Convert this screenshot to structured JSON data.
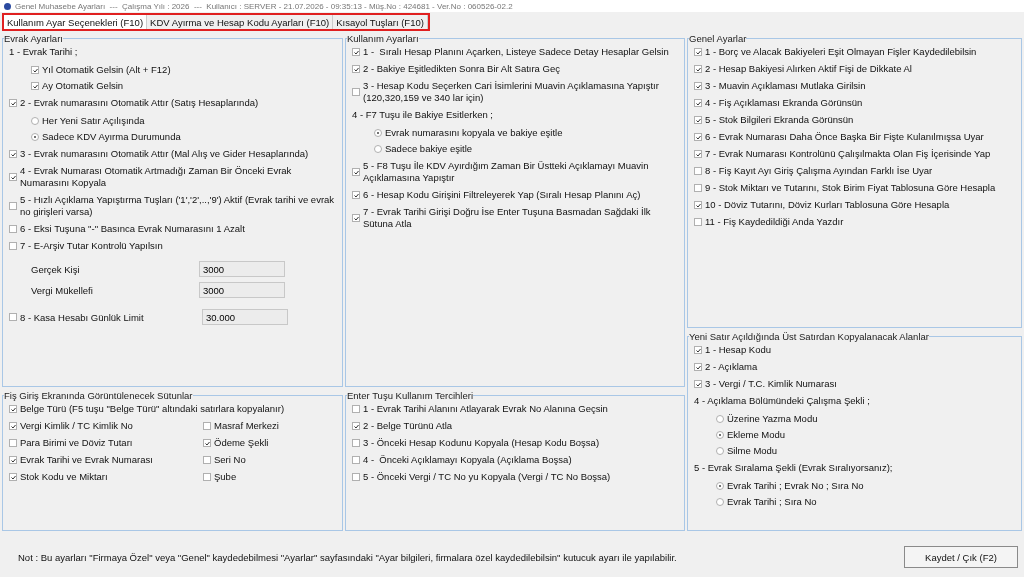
{
  "window": {
    "title": "Genel Muhasebe Ayarları  ---  Çalışma Yılı : 2026  ---  Kullanıcı : SERVER - 21.07.2026 - 09:35:13 - Müş.No : 424681 - Ver.No : 060526-02.2"
  },
  "tabs": [
    {
      "label": "Kullanım Ayar Seçenekleri (F10)",
      "selected": true
    },
    {
      "label": "KDV Ayırma ve Hesap Kodu Ayarları (F10)",
      "selected": false
    },
    {
      "label": "Kısayol Tuşları (F10)",
      "selected": false
    }
  ],
  "columns": [
    [
      {
        "title": "Evrak Ayarları",
        "items": [
          {
            "kind": "label",
            "text": "1 - Evrak Tarihi ;",
            "children": [
              {
                "kind": "check",
                "text": "Yıl Otomatik Gelsin (Alt + F12)",
                "checked": true
              },
              {
                "kind": "check",
                "text": "Ay Otomatik Gelsin",
                "checked": true
              }
            ]
          },
          {
            "kind": "check",
            "text": "2 - Evrak numarasını Otomatik Attır (Satış Hesaplarında)",
            "checked": true,
            "children": [
              {
                "kind": "radio",
                "text": "Her Yeni Satır Açılışında",
                "selected": false
              },
              {
                "kind": "radio",
                "text": "Sadece KDV Ayırma Durumunda",
                "selected": true
              }
            ]
          },
          {
            "kind": "check",
            "text": "3 - Evrak numarasını Otomatik Attır (Mal Alış ve Gider Hesaplarında)",
            "checked": true
          },
          {
            "kind": "check",
            "text": "4 - Evrak Numarası Otomatik Artmadığı Zaman Bir Önceki Evrak Numarasını Kopyala",
            "checked": true
          },
          {
            "kind": "check",
            "text": "5 - Hızlı Açıklama Yapıştırma Tuşları ('1','2',..,'9') Aktif (Evrak tarihi ve evrak no girişleri varsa)",
            "checked": false
          },
          {
            "kind": "check",
            "text": "6 - Eksi Tuşuna \"-\" Basınca Evrak Numarasını 1 Azalt",
            "checked": false
          },
          {
            "kind": "check",
            "text": "7 - E-Arşiv Tutar Kontrolü Yapılsın",
            "checked": false,
            "children": [
              {
                "kind": "field",
                "text": "Gerçek Kişi",
                "value": "3000"
              },
              {
                "kind": "field",
                "text": "Vergi Mükellefi",
                "value": "3000"
              }
            ]
          },
          {
            "kind": "check_field",
            "text": "8 - Kasa Hesabı Günlük Limit",
            "checked": false,
            "value": "30.000"
          }
        ]
      },
      {
        "title": "Fiş Giriş Ekranında Görüntülenecek Sütunlar",
        "items": [
          {
            "kind": "check",
            "text": "Belge Türü (F5 tuşu \"Belge Türü\" altındaki satırlara kopyalanır)",
            "checked": true
          },
          {
            "kind": "pair",
            "cells": [
              {
                "text": "Vergi Kimlik / TC Kimlik No",
                "checked": true
              },
              {
                "text": "Masraf Merkezi",
                "checked": false
              }
            ]
          },
          {
            "kind": "pair",
            "cells": [
              {
                "text": "Para Birimi ve Döviz Tutarı",
                "checked": false
              },
              {
                "text": "Ödeme Şekli",
                "checked": true
              }
            ]
          },
          {
            "kind": "pair",
            "cells": [
              {
                "text": "Evrak Tarihi ve Evrak Numarası",
                "checked": true
              },
              {
                "text": "Seri No",
                "checked": false
              }
            ]
          },
          {
            "kind": "pair",
            "cells": [
              {
                "text": "Stok Kodu ve Miktarı",
                "checked": true
              },
              {
                "text": "Şube",
                "checked": false
              }
            ]
          }
        ]
      }
    ],
    [
      {
        "title": "Kullanım Ayarları",
        "items": [
          {
            "kind": "check",
            "text": "1 -  Sıralı Hesap Planını Açarken, Listeye Sadece Detay Hesaplar Gelsin",
            "checked": true
          },
          {
            "kind": "check",
            "text": "2 - Bakiye Eşitledikten Sonra Bir Alt Satıra Geç",
            "checked": true
          },
          {
            "kind": "check",
            "text": "3 - Hesap Kodu Seçerken Cari İsimlerini Muavin Açıklamasına Yapıştır (120,320,159 ve 340 lar için)",
            "checked": false
          },
          {
            "kind": "label",
            "text": "4 - F7 Tuşu ile Bakiye Esitlerken ;",
            "children": [
              {
                "kind": "radio",
                "text": "Evrak numarasını kopyala ve bakiye eşitle",
                "selected": true
              },
              {
                "kind": "radio",
                "text": "Sadece bakiye eşitle",
                "selected": false
              }
            ]
          },
          {
            "kind": "check",
            "text": "5 - F8 Tuşu İle KDV Ayırdığım Zaman Bir Üstteki Açıklamayı Muavin Açıklamasına Yapıştır",
            "checked": true
          },
          {
            "kind": "check",
            "text": "6 - Hesap Kodu Girişini Filtreleyerek Yap (Sıralı Hesap Planını Aç)",
            "checked": true
          },
          {
            "kind": "check",
            "text": "7 - Evrak Tarihi Girişi Doğru İse Enter Tuşuna Basmadan Sağdaki İlk Sütuna Atla",
            "checked": true
          }
        ]
      },
      {
        "title": "Enter Tuşu Kullanım Tercihleri",
        "items": [
          {
            "kind": "check",
            "text": "1 - Evrak Tarihi Alanını Atlayarak Evrak No Alanına Geçsin",
            "checked": false
          },
          {
            "kind": "check",
            "text": "2 - Belge Türünü Atla",
            "checked": true
          },
          {
            "kind": "check",
            "text": "3 - Önceki Hesap Kodunu Kopyala (Hesap Kodu Boşsa)",
            "checked": false
          },
          {
            "kind": "check",
            "text": "4 -  Önceki Açıklamayı Kopyala (Açıklama Boşsa)",
            "checked": false
          },
          {
            "kind": "check",
            "text": "5 - Önceki Vergi / TC No yu Kopyala (Vergi / TC No Boşsa)",
            "checked": false
          }
        ]
      }
    ],
    [
      {
        "title": "Genel Ayarlar",
        "items": [
          {
            "kind": "check",
            "text": "1 - Borç ve Alacak Bakiyeleri Eşit Olmayan Fişler Kaydedilebilsin",
            "checked": true
          },
          {
            "kind": "check",
            "text": "2 - Hesap Bakiyesi Alırken Aktif Fişi de Dikkate Al",
            "checked": true
          },
          {
            "kind": "check",
            "text": "3 - Muavin Açıklaması Mutlaka Girilsin",
            "checked": true
          },
          {
            "kind": "check",
            "text": "4 - Fiş Açıklaması Ekranda Görünsün",
            "checked": true
          },
          {
            "kind": "check",
            "text": "5 - Stok Bilgileri Ekranda Görünsün",
            "checked": true
          },
          {
            "kind": "check",
            "text": "6 - Evrak Numarası Daha Önce Başka Bir Fişte Kulanılmışsa Uyar",
            "checked": true
          },
          {
            "kind": "check",
            "text": "7 - Evrak Numarası Kontrolünü Çalışılmakta Olan Fiş İçerisinde Yap",
            "checked": true
          },
          {
            "kind": "check",
            "text": "8 - Fiş Kayıt Ayı Giriş Çalışma Ayından Farklı İse Uyar",
            "checked": false
          },
          {
            "kind": "check",
            "text": "9 - Stok Miktarı ve Tutarını, Stok Birim Fiyat Tablosuna Göre Hesapla",
            "checked": false
          },
          {
            "kind": "check",
            "text": "10 - Döviz Tutarını, Döviz Kurları Tablosuna Göre Hesapla",
            "checked": true
          },
          {
            "kind": "check",
            "text": "11 - Fiş Kaydedildiği Anda Yazdır",
            "checked": false
          }
        ]
      },
      {
        "title": "Yeni Satır Açıldığında Üst Satırdan Kopyalanacak Alanlar",
        "items": [
          {
            "kind": "check",
            "text": "1 - Hesap Kodu",
            "checked": true
          },
          {
            "kind": "check",
            "text": "2 - Açıklama",
            "checked": true
          },
          {
            "kind": "check",
            "text": "3 - Vergi / T.C. Kimlik Numarası",
            "checked": true
          },
          {
            "kind": "label",
            "text": "4 - Açıklama Bölümündeki Çalışma Şekli ;",
            "children": [
              {
                "kind": "radio",
                "text": "Üzerine Yazma Modu",
                "selected": false
              },
              {
                "kind": "radio",
                "text": "Ekleme Modu",
                "selected": true
              },
              {
                "kind": "radio",
                "text": "Silme Modu",
                "selected": false
              }
            ]
          },
          {
            "kind": "label",
            "text": "5 - Evrak Sıralama Şekli (Evrak Sıralıyorsanız);",
            "children": [
              {
                "kind": "radio",
                "text": "Evrak Tarihi ; Evrak No ; Sıra No",
                "selected": true
              },
              {
                "kind": "radio",
                "text": "Evrak Tarihi ; Sıra No",
                "selected": false
              }
            ]
          }
        ]
      }
    ]
  ],
  "note": "Not : Bu ayarları \"Firmaya Özel\" veya \"Genel\" kaydedebilmesi \"Ayarlar\" sayfasındaki \"Ayar bilgileri, firmalara özel kaydedilebilsin\" kutucuk ayarı ile yapılabilir.",
  "save_button": "Kaydet / Çık (F2)"
}
